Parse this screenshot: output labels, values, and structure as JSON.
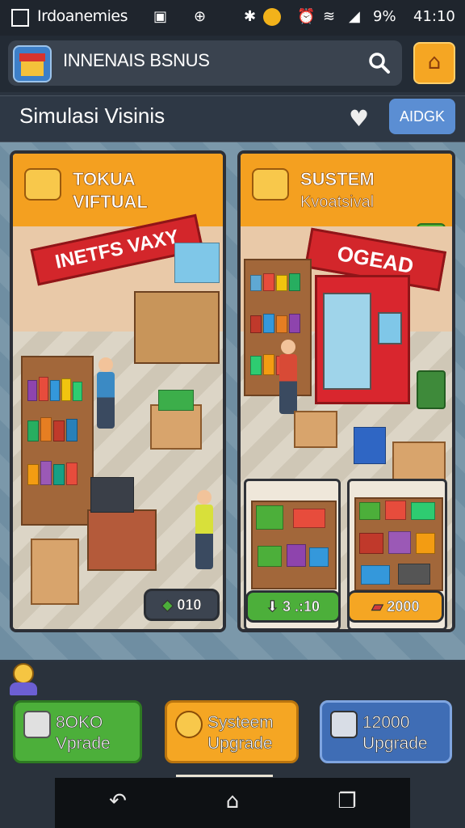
{
  "status_bar": {
    "app_name": "Irdoanemies",
    "battery": "9%",
    "time": "41:10"
  },
  "header": {
    "title": "INNENAIS BSNUS",
    "subtitle": "Simulasi Visinis",
    "add_button": "AIDGK"
  },
  "cards": [
    {
      "title_line1": "TOKUA",
      "title_line2": "VIFTUAL",
      "sign": "INETFS VAXY",
      "value": "010"
    },
    {
      "title_line1": "SUSTEM",
      "title_line2": "Kvoatsival",
      "sign": "OGEAD",
      "slots": [
        {
          "value": "3 .:10",
          "color": "#4caf3a"
        },
        {
          "value": "2000",
          "color": "#f5a623"
        }
      ]
    }
  ],
  "upgrades": [
    {
      "line1": "8OKO",
      "line2": "Vprade",
      "color": "#4caf3a"
    },
    {
      "line1": "Systeem",
      "line2": "Upgrade",
      "color": "#f5a623"
    },
    {
      "line1": "12000",
      "line2": "Upgrade",
      "color": "#3f6db5"
    }
  ],
  "icons": [
    "app-icon",
    "search-icon",
    "home-icon",
    "heart-icon",
    "close-icon",
    "back-icon",
    "home-nav-icon",
    "recents-icon"
  ]
}
